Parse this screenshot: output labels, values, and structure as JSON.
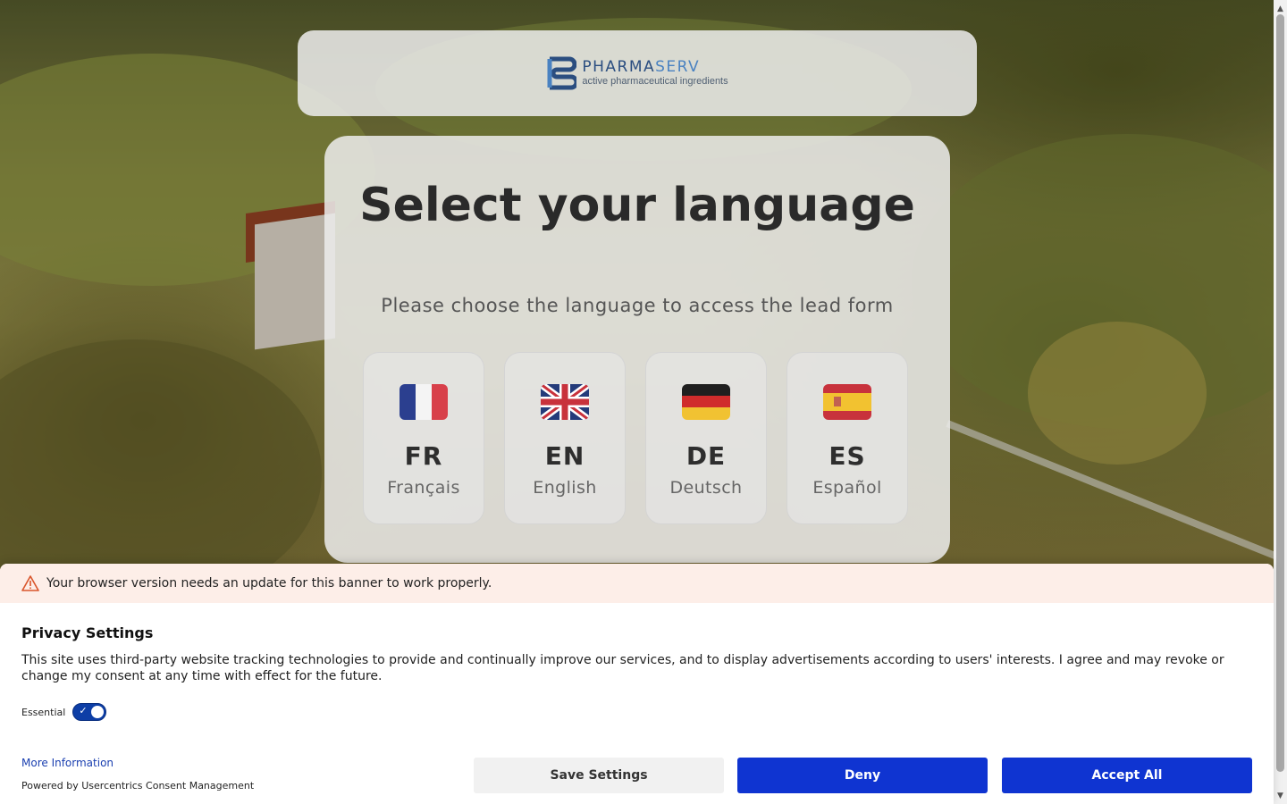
{
  "brand": {
    "name_part1": "PHARMA",
    "name_part2": "SERV",
    "tagline": "active pharmaceutical ingredients",
    "colors": {
      "primary": "#2b4e80",
      "accent": "#4a82c1"
    }
  },
  "language_selector": {
    "title": "Select your language",
    "subtitle": "Please choose the language to access the lead form",
    "options": [
      {
        "code": "FR",
        "name": "Français",
        "flag": "france-flag-icon"
      },
      {
        "code": "EN",
        "name": "English",
        "flag": "uk-flag-icon"
      },
      {
        "code": "DE",
        "name": "Deutsch",
        "flag": "germany-flag-icon"
      },
      {
        "code": "ES",
        "name": "Español",
        "flag": "spain-flag-icon"
      }
    ]
  },
  "consent_banner": {
    "warning_icon": "warning-triangle-icon",
    "warning_text": "Your browser version needs an update for this banner to work properly.",
    "title": "Privacy Settings",
    "description": "This site uses third-party website tracking technologies to provide and continually improve our services, and to display advertisements according to users' interests. I agree and may revoke or change my consent at any time with effect for the future.",
    "essential_label": "Essential",
    "essential_enabled": true,
    "more_info_label": "More Information",
    "powered_by": "Powered by Usercentrics Consent Management",
    "buttons": {
      "save": "Save Settings",
      "deny": "Deny",
      "accept": "Accept All"
    },
    "colors": {
      "button_primary": "#0f34d1",
      "warning_bg": "#fdeee8",
      "toggle": "#0d3ea6"
    }
  }
}
